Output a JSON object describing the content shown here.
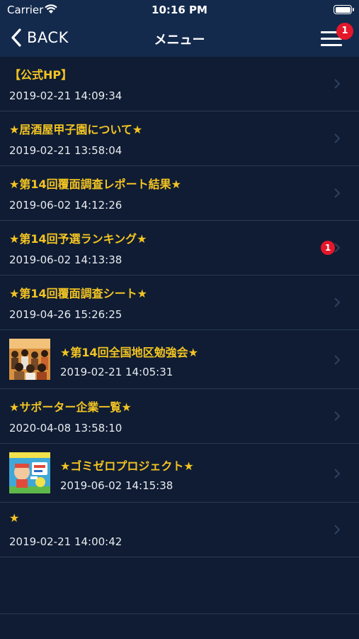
{
  "status_bar": {
    "carrier": "Carrier",
    "time": "10:16 PM"
  },
  "nav": {
    "back_label": "BACK",
    "title": "メニュー",
    "menu_badge": "1"
  },
  "items": [
    {
      "title": "【公式HP】",
      "date": "2019-02-21 14:09:34"
    },
    {
      "title": "★居酒屋甲子園について★",
      "date": "2019-02-21 13:58:04"
    },
    {
      "title": "★第14回覆面調査レポート結果★",
      "date": "2019-06-02 14:12:26"
    },
    {
      "title": "★第14回予選ランキング★",
      "date": "2019-06-02 14:13:38",
      "badge": "1"
    },
    {
      "title": "★第14回覆面調査シート★",
      "date": "2019-04-26 15:26:25"
    },
    {
      "title": "★第14回全国地区勉強会★",
      "date": "2019-02-21 14:05:31",
      "thumbnail": "seminar-photo"
    },
    {
      "title": "★サポーター企業一覧★",
      "date": "2020-04-08 13:58:10"
    },
    {
      "title": "★ゴミゼロプロジェクト★",
      "date": "2019-06-02 14:15:38",
      "thumbnail": "project-poster"
    },
    {
      "title": "★",
      "date": "2019-02-21 14:00:42"
    }
  ],
  "colors": {
    "background": "#0f1c33",
    "header": "#132a4d",
    "title": "#f3c423",
    "badge": "#e5172a"
  }
}
